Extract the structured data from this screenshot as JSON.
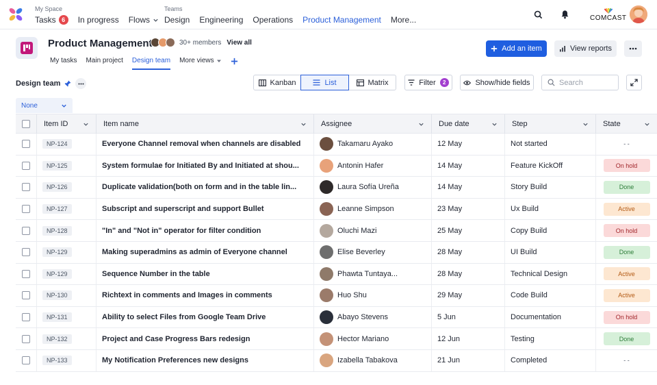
{
  "topnav": {
    "my_space_caption": "My Space",
    "teams_caption": "Teams",
    "my_space_items": [
      {
        "label": "Tasks",
        "badge": "6"
      },
      {
        "label": "In progress"
      },
      {
        "label": "Flows"
      }
    ],
    "team_items": [
      {
        "label": "Design"
      },
      {
        "label": "Engineering"
      },
      {
        "label": "Operations"
      },
      {
        "label": "Product Management"
      },
      {
        "label": "More..."
      }
    ],
    "brand": "COMCAST",
    "icons": [
      "search-icon",
      "bell-icon"
    ]
  },
  "project": {
    "title": "Product Management",
    "members_count": "30+ members",
    "view_all": "View all",
    "tabs": [
      {
        "label": "My tasks"
      },
      {
        "label": "Main project"
      },
      {
        "label": "Design team"
      },
      {
        "label": "More views"
      }
    ],
    "add_item_label": "Add an item",
    "view_reports_label": "View reports"
  },
  "toolbar": {
    "group_title": "Design team",
    "views": [
      {
        "label": "Kanban"
      },
      {
        "label": "List"
      },
      {
        "label": "Matrix"
      }
    ],
    "filter_label": "Filter",
    "filter_count": "2",
    "show_hide_label": "Show/hide fields",
    "search_placeholder": "Search",
    "grouping_value": "None"
  },
  "colors": {
    "accent": "#2b5fd9",
    "primary_button": "#1f5ee0",
    "badge_red": "#e5484d",
    "badge_purple": "#a23fcf"
  },
  "table": {
    "columns": [
      "Item ID",
      "Item name",
      "Assignee",
      "Due date",
      "Step",
      "State"
    ],
    "rows": [
      {
        "id": "NP-124",
        "name": "Everyone Channel removal when channels are disabled",
        "assignee": "Takamaru Ayako",
        "due": "12 May",
        "step": "Not started",
        "state": "- -"
      },
      {
        "id": "NP-125",
        "name": "System formulae for Initiated By and Initiated at shou...",
        "assignee": "Antonin Hafer",
        "due": "14 May",
        "step": "Feature KickOff",
        "state": "On hold"
      },
      {
        "id": "NP-126",
        "name": "Duplicate validation(both on form and in the table lin...",
        "assignee": "Laura Sofía Ureña",
        "due": "14 May",
        "step": "Story Build",
        "state": "Done"
      },
      {
        "id": "NP-127",
        "name": "Subscript and superscript  and support Bullet",
        "assignee": "Leanne Simpson",
        "due": "23 May",
        "step": "Ux Build",
        "state": "Active"
      },
      {
        "id": "NP-128",
        "name": "\"In\" and \"Not in\" operator for filter condition",
        "assignee": "Oluchi Mazi",
        "due": "25 May",
        "step": "Copy Build",
        "state": "On hold"
      },
      {
        "id": "NP-129",
        "name": "Making superadmins as admin of Everyone channel",
        "assignee": "Elise Beverley",
        "due": "28 May",
        "step": "UI Build",
        "state": "Done"
      },
      {
        "id": "NP-129",
        "name": "Sequence Number in the table",
        "assignee": "Phawta Tuntaya...",
        "due": "28 May",
        "step": "Technical Design",
        "state": "Active"
      },
      {
        "id": "NP-130",
        "name": "Richtext in comments and Images in comments",
        "assignee": "Huo Shu",
        "due": "29 May",
        "step": "Code Build",
        "state": "Active"
      },
      {
        "id": "NP-131",
        "name": "Ability to select Files from Google Team Drive",
        "assignee": "Abayo Stevens",
        "due": "5 Jun",
        "step": "Documentation",
        "state": "On hold"
      },
      {
        "id": "NP-132",
        "name": "Project and Case Progress Bars redesign",
        "assignee": "Hector Mariano",
        "due": "12 Jun",
        "step": "Testing",
        "state": "Done"
      },
      {
        "id": "NP-133",
        "name": "My Notification Preferences new designs",
        "assignee": "Izabella Tabakova",
        "due": "21 Jun",
        "step": "Completed",
        "state": "- -"
      }
    ]
  }
}
